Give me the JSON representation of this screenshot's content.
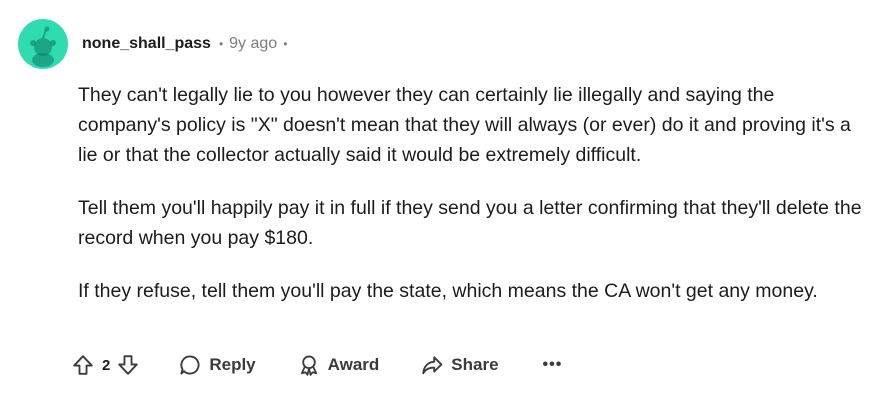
{
  "comment": {
    "author": "none_shall_pass",
    "separator": "•",
    "age": "9y ago",
    "paragraphs": [
      "They can't legally lie to you however they can certainly lie illegally and saying the company's policy is \"X\" doesn't mean that they will always (or ever) do it and proving it's a lie or that the collector actually said it would be extremely difficult.",
      "Tell them you'll happily pay it in full if they send you a letter confirming that they'll delete the record when you pay $180.",
      "If they refuse, tell them you'll pay the state, which means the CA won't get any money."
    ]
  },
  "actions": {
    "vote_count": "2",
    "reply_label": "Reply",
    "award_label": "Award",
    "share_label": "Share",
    "more_label": "•••"
  },
  "icons": {
    "avatar": "snoo-avatar-icon",
    "upvote": "upvote-arrow-icon",
    "downvote": "downvote-arrow-icon",
    "reply": "speech-bubble-icon",
    "award": "award-ribbon-icon",
    "share": "share-arrow-icon"
  },
  "colors": {
    "avatar_bg": "#2fdcb0",
    "text": "#1c1c1c",
    "muted": "#7c7c7c"
  }
}
